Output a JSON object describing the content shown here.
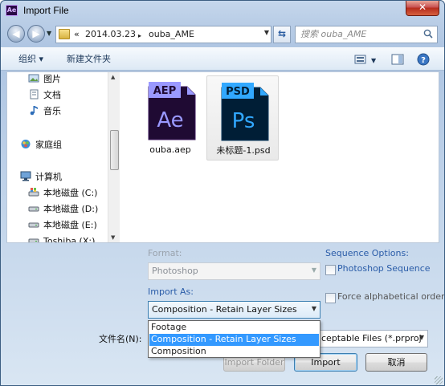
{
  "window": {
    "title": "Import File",
    "app_logo_text": "Ae",
    "close_glyph": "✕"
  },
  "address": {
    "prefix": "«",
    "crumbs": [
      "2014.03.23",
      "ouba_AME"
    ],
    "separator": "▸"
  },
  "search": {
    "placeholder": "搜索 ouba_AME"
  },
  "toolbar": {
    "organize": "组织 ▾",
    "new_folder": "新建文件夹"
  },
  "nav": {
    "items": [
      {
        "label": "图片",
        "icon": "pictures-icon"
      },
      {
        "label": "文档",
        "icon": "documents-icon"
      },
      {
        "label": "音乐",
        "icon": "music-icon"
      },
      {
        "label": "家庭组",
        "icon": "homegroup-icon"
      },
      {
        "label": "计算机",
        "icon": "computer-icon"
      },
      {
        "label": "本地磁盘 (C:)",
        "icon": "drive-icon"
      },
      {
        "label": "本地磁盘 (D:)",
        "icon": "drive-icon"
      },
      {
        "label": "本地磁盘 (E:)",
        "icon": "drive-icon"
      },
      {
        "label": "Toshiba (X:)",
        "icon": "drive-icon"
      }
    ]
  },
  "files": [
    {
      "name": "ouba.aep",
      "badge": "AEP",
      "letters": "Ae",
      "color": "#9a99ff",
      "bg": "#1f0a33"
    },
    {
      "name": "未标题-1.psd",
      "badge": "PSD",
      "letters": "Ps",
      "color": "#31a8ff",
      "bg": "#001e36"
    }
  ],
  "options": {
    "format_label": "Format:",
    "format_value": "Photoshop",
    "sequence_label": "Sequence Options:",
    "sequence_check": "Photoshop Sequence",
    "import_as_label": "Import As:",
    "import_as_value": "Composition - Retain Layer Sizes",
    "force_alpha": "Force alphabetical order",
    "dropdown_options": [
      "Footage",
      "Composition - Retain Layer Sizes",
      "Composition"
    ],
    "filename_label": "文件名(N):",
    "filetype_value": "ceptable Files (*.prproj"
  },
  "buttons": {
    "import_folder": "Import Folder",
    "import": "Import",
    "cancel": "取消"
  }
}
